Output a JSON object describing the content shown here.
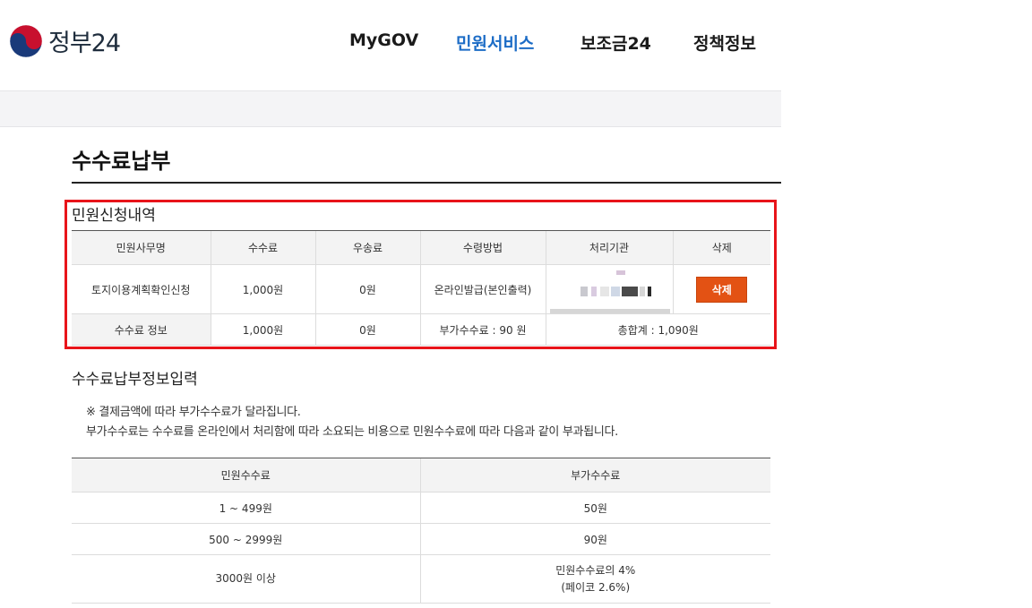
{
  "header": {
    "logo_text": "정부24",
    "nav": [
      "MyGOV",
      "민원서비스",
      "보조금24",
      "정책정보"
    ],
    "active_nav": "민원서비스"
  },
  "page": {
    "title": "수수료납부"
  },
  "apply_section": {
    "heading": "민원신청내역",
    "columns": [
      "민원사무명",
      "수수료",
      "우송료",
      "수령방법",
      "처리기관",
      "삭제"
    ],
    "row": {
      "service_name": "토지이용계획확인신청",
      "fee": "1,000원",
      "postage": "0원",
      "receive_method": "온라인발급(본인출력)",
      "agency": "",
      "delete_label": "삭제"
    },
    "fee_info": {
      "label": "수수료 정보",
      "fee": "1,000원",
      "postage": "0원",
      "extra_fee": "부가수수료 : 90 원",
      "total": "총합계 : 1,090원"
    }
  },
  "payment_section": {
    "heading": "수수료납부정보입력",
    "notice_line1": "※ 결제금액에 따라 부가수수료가 달라집니다.",
    "notice_line2": "부가수수료는 수수료를 온라인에서 처리함에 따라 소요되는 비용으로 민원수수료에 따라 다음과 같이 부과됩니다.",
    "columns": [
      "민원수수료",
      "부가수수료"
    ],
    "rows": [
      {
        "range": "1 ~ 499원",
        "extra": "50원"
      },
      {
        "range": "500 ~ 2999원",
        "extra": "90원"
      },
      {
        "range": "3000원 이상",
        "extra_line1": "민원수수료의 4%",
        "extra_line2": "(페이코 2.6%)"
      }
    ]
  },
  "colors": {
    "accent": "#1c6cc6",
    "highlight": "#e8141a",
    "delete_button": "#e35214"
  },
  "icons": {
    "logo": "korea-taegeuk-icon"
  }
}
